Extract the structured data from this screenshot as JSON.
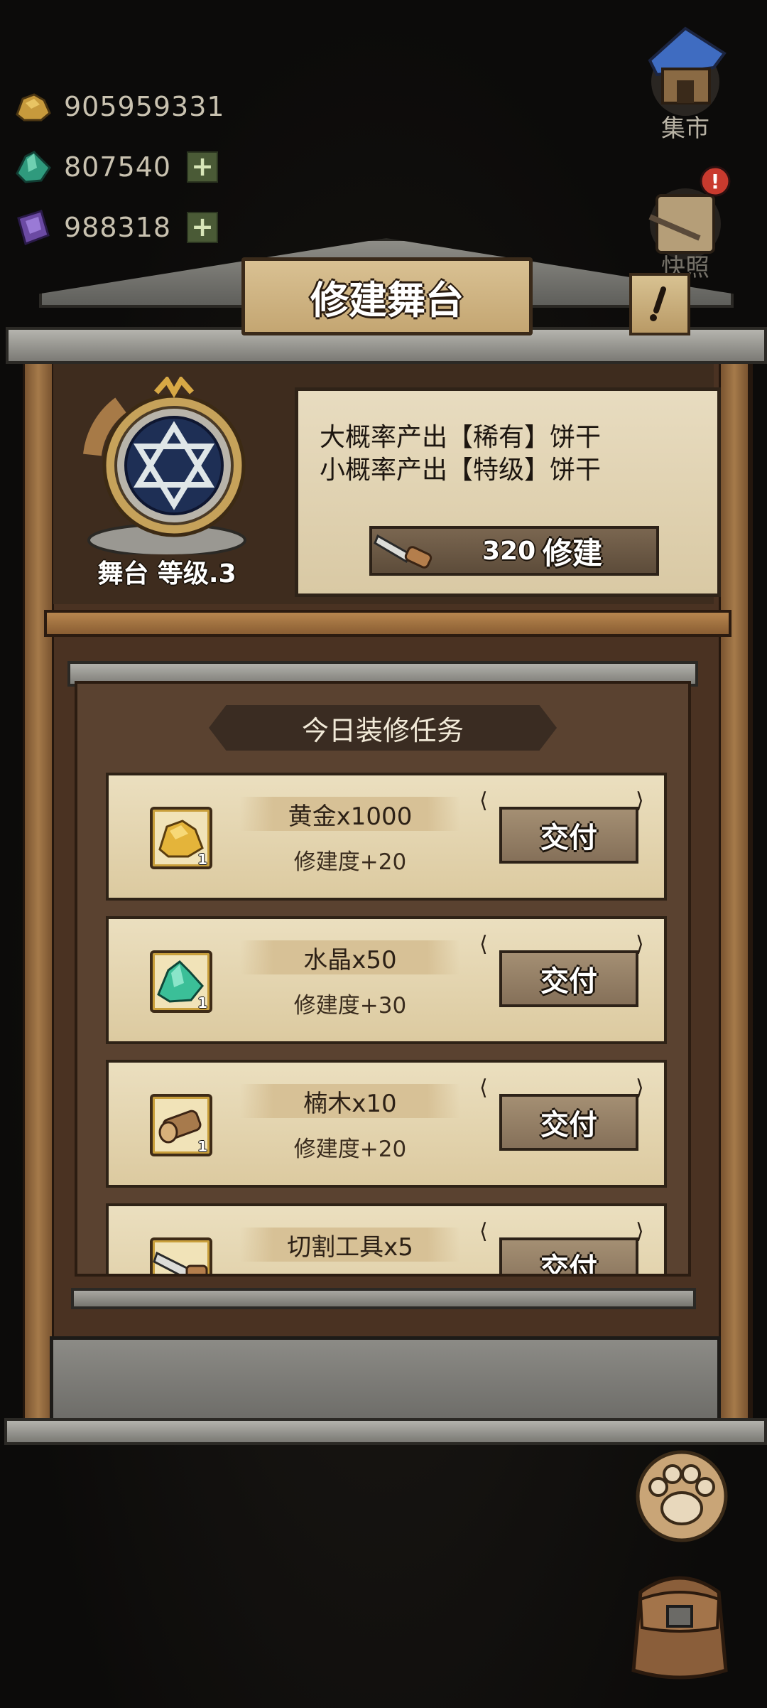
{
  "currencies": [
    {
      "name": "gold-icon",
      "value": "905959331",
      "has_plus": false,
      "color": "#c79a3c"
    },
    {
      "name": "crystal-icon",
      "value": "807540",
      "has_plus": true,
      "color": "#2f9a7d"
    },
    {
      "name": "gem-icon",
      "value": "988318",
      "has_plus": true,
      "color": "#6b4aa3"
    }
  ],
  "plus_symbol": "+",
  "side_buttons": {
    "market_label": "集市",
    "notice_label": "快照"
  },
  "panel": {
    "title": "修建舞台",
    "help_icon": "!",
    "stage_level_label": "舞台 等级.3",
    "info_lines": [
      "大概率产出【稀有】饼干",
      "小概率产出【特级】饼干"
    ],
    "build_cost": "320",
    "build_label": "修建"
  },
  "tasks": {
    "title": "今日装修任务",
    "items": [
      {
        "icon": "gold-ore-icon",
        "name": "黄金x1000",
        "progress": "修建度+20",
        "count": "1",
        "button": "交付"
      },
      {
        "icon": "crystal-ore-icon",
        "name": "水晶x50",
        "progress": "修建度+30",
        "count": "1",
        "button": "交付"
      },
      {
        "icon": "wood-log-icon",
        "name": "楠木x10",
        "progress": "修建度+20",
        "count": "1",
        "button": "交付"
      },
      {
        "icon": "saw-tool-icon",
        "name": "切割工具x5",
        "progress": "",
        "count": "",
        "button": "交付"
      }
    ]
  },
  "colors": {
    "wood_dark": "#4a3222",
    "parchment": "#e8dcc0",
    "stone": "#8e8d87",
    "accent_text_outline": "#1c140c"
  }
}
